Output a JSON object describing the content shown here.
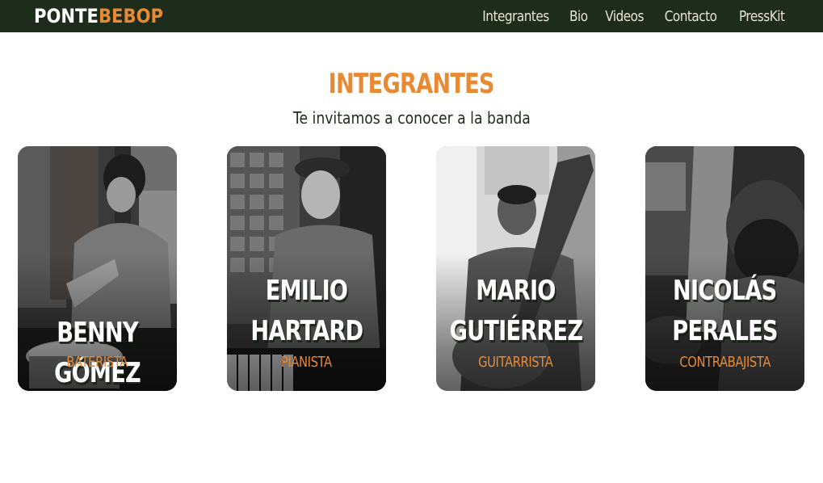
{
  "brand": {
    "part1": "PONTE",
    "part2": "BEBOP"
  },
  "nav": {
    "links": [
      {
        "label": "Integrantes"
      },
      {
        "label": "Bio"
      },
      {
        "label": "Videos"
      },
      {
        "label": "Contacto"
      },
      {
        "label": "PressKit"
      }
    ]
  },
  "section": {
    "title": "INTEGRANTES",
    "subtitle": "Te invitamos a conocer a la banda"
  },
  "members": [
    {
      "name_line1": "",
      "name_line2": "BENNY GÓMEZ",
      "role": "BATERISTA"
    },
    {
      "name_line1": "EMILIO",
      "name_line2": "HARTARD",
      "role": "PIANISTA"
    },
    {
      "name_line1": "MARIO",
      "name_line2": "GUTIÉRREZ",
      "role": "GUITARRISTA"
    },
    {
      "name_line1": "NICOLÁS",
      "name_line2": "PERALES",
      "role": "CONTRABAJISTA"
    }
  ],
  "colors": {
    "navbar": "#1e2c1c",
    "accent": "#e88a33",
    "text": "#1e2c1c"
  }
}
